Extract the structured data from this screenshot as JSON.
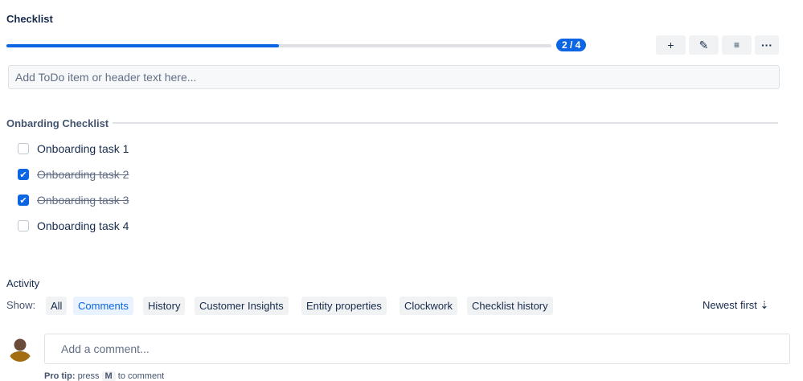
{
  "checklist": {
    "title": "Checklist",
    "progress": 0.5,
    "progress_label": "2 / 4",
    "add_placeholder": "Add ToDo item or header text here...",
    "section": "Onbarding Checklist",
    "items": [
      {
        "label": "Onboarding task 1",
        "checked": false
      },
      {
        "label": "Onboarding task 2",
        "checked": true
      },
      {
        "label": "Onboarding task 3",
        "checked": true
      },
      {
        "label": "Onboarding task 4",
        "checked": false
      }
    ]
  },
  "activity": {
    "title": "Activity",
    "show_label": "Show:",
    "filters": [
      "All",
      "Comments",
      "History",
      "Customer Insights",
      "Entity properties",
      "Clockwork",
      "Checklist history"
    ],
    "selected": "Comments",
    "sort": "Newest first",
    "comment_placeholder": "Add a comment...",
    "tip_prefix": "Pro tip:",
    "tip_press": "press",
    "tip_key": "M",
    "tip_suffix": "to comment"
  }
}
